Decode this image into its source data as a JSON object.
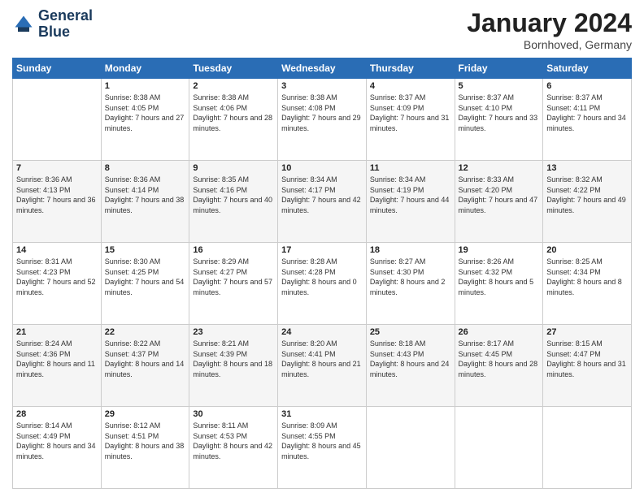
{
  "logo": {
    "line1": "General",
    "line2": "Blue"
  },
  "title": "January 2024",
  "subtitle": "Bornhoved, Germany",
  "weekdays": [
    "Sunday",
    "Monday",
    "Tuesday",
    "Wednesday",
    "Thursday",
    "Friday",
    "Saturday"
  ],
  "weeks": [
    [
      {
        "day": "",
        "sunrise": "",
        "sunset": "",
        "daylight": ""
      },
      {
        "day": "1",
        "sunrise": "Sunrise: 8:38 AM",
        "sunset": "Sunset: 4:05 PM",
        "daylight": "Daylight: 7 hours and 27 minutes."
      },
      {
        "day": "2",
        "sunrise": "Sunrise: 8:38 AM",
        "sunset": "Sunset: 4:06 PM",
        "daylight": "Daylight: 7 hours and 28 minutes."
      },
      {
        "day": "3",
        "sunrise": "Sunrise: 8:38 AM",
        "sunset": "Sunset: 4:08 PM",
        "daylight": "Daylight: 7 hours and 29 minutes."
      },
      {
        "day": "4",
        "sunrise": "Sunrise: 8:37 AM",
        "sunset": "Sunset: 4:09 PM",
        "daylight": "Daylight: 7 hours and 31 minutes."
      },
      {
        "day": "5",
        "sunrise": "Sunrise: 8:37 AM",
        "sunset": "Sunset: 4:10 PM",
        "daylight": "Daylight: 7 hours and 33 minutes."
      },
      {
        "day": "6",
        "sunrise": "Sunrise: 8:37 AM",
        "sunset": "Sunset: 4:11 PM",
        "daylight": "Daylight: 7 hours and 34 minutes."
      }
    ],
    [
      {
        "day": "7",
        "sunrise": "Sunrise: 8:36 AM",
        "sunset": "Sunset: 4:13 PM",
        "daylight": "Daylight: 7 hours and 36 minutes."
      },
      {
        "day": "8",
        "sunrise": "Sunrise: 8:36 AM",
        "sunset": "Sunset: 4:14 PM",
        "daylight": "Daylight: 7 hours and 38 minutes."
      },
      {
        "day": "9",
        "sunrise": "Sunrise: 8:35 AM",
        "sunset": "Sunset: 4:16 PM",
        "daylight": "Daylight: 7 hours and 40 minutes."
      },
      {
        "day": "10",
        "sunrise": "Sunrise: 8:34 AM",
        "sunset": "Sunset: 4:17 PM",
        "daylight": "Daylight: 7 hours and 42 minutes."
      },
      {
        "day": "11",
        "sunrise": "Sunrise: 8:34 AM",
        "sunset": "Sunset: 4:19 PM",
        "daylight": "Daylight: 7 hours and 44 minutes."
      },
      {
        "day": "12",
        "sunrise": "Sunrise: 8:33 AM",
        "sunset": "Sunset: 4:20 PM",
        "daylight": "Daylight: 7 hours and 47 minutes."
      },
      {
        "day": "13",
        "sunrise": "Sunrise: 8:32 AM",
        "sunset": "Sunset: 4:22 PM",
        "daylight": "Daylight: 7 hours and 49 minutes."
      }
    ],
    [
      {
        "day": "14",
        "sunrise": "Sunrise: 8:31 AM",
        "sunset": "Sunset: 4:23 PM",
        "daylight": "Daylight: 7 hours and 52 minutes."
      },
      {
        "day": "15",
        "sunrise": "Sunrise: 8:30 AM",
        "sunset": "Sunset: 4:25 PM",
        "daylight": "Daylight: 7 hours and 54 minutes."
      },
      {
        "day": "16",
        "sunrise": "Sunrise: 8:29 AM",
        "sunset": "Sunset: 4:27 PM",
        "daylight": "Daylight: 7 hours and 57 minutes."
      },
      {
        "day": "17",
        "sunrise": "Sunrise: 8:28 AM",
        "sunset": "Sunset: 4:28 PM",
        "daylight": "Daylight: 8 hours and 0 minutes."
      },
      {
        "day": "18",
        "sunrise": "Sunrise: 8:27 AM",
        "sunset": "Sunset: 4:30 PM",
        "daylight": "Daylight: 8 hours and 2 minutes."
      },
      {
        "day": "19",
        "sunrise": "Sunrise: 8:26 AM",
        "sunset": "Sunset: 4:32 PM",
        "daylight": "Daylight: 8 hours and 5 minutes."
      },
      {
        "day": "20",
        "sunrise": "Sunrise: 8:25 AM",
        "sunset": "Sunset: 4:34 PM",
        "daylight": "Daylight: 8 hours and 8 minutes."
      }
    ],
    [
      {
        "day": "21",
        "sunrise": "Sunrise: 8:24 AM",
        "sunset": "Sunset: 4:36 PM",
        "daylight": "Daylight: 8 hours and 11 minutes."
      },
      {
        "day": "22",
        "sunrise": "Sunrise: 8:22 AM",
        "sunset": "Sunset: 4:37 PM",
        "daylight": "Daylight: 8 hours and 14 minutes."
      },
      {
        "day": "23",
        "sunrise": "Sunrise: 8:21 AM",
        "sunset": "Sunset: 4:39 PM",
        "daylight": "Daylight: 8 hours and 18 minutes."
      },
      {
        "day": "24",
        "sunrise": "Sunrise: 8:20 AM",
        "sunset": "Sunset: 4:41 PM",
        "daylight": "Daylight: 8 hours and 21 minutes."
      },
      {
        "day": "25",
        "sunrise": "Sunrise: 8:18 AM",
        "sunset": "Sunset: 4:43 PM",
        "daylight": "Daylight: 8 hours and 24 minutes."
      },
      {
        "day": "26",
        "sunrise": "Sunrise: 8:17 AM",
        "sunset": "Sunset: 4:45 PM",
        "daylight": "Daylight: 8 hours and 28 minutes."
      },
      {
        "day": "27",
        "sunrise": "Sunrise: 8:15 AM",
        "sunset": "Sunset: 4:47 PM",
        "daylight": "Daylight: 8 hours and 31 minutes."
      }
    ],
    [
      {
        "day": "28",
        "sunrise": "Sunrise: 8:14 AM",
        "sunset": "Sunset: 4:49 PM",
        "daylight": "Daylight: 8 hours and 34 minutes."
      },
      {
        "day": "29",
        "sunrise": "Sunrise: 8:12 AM",
        "sunset": "Sunset: 4:51 PM",
        "daylight": "Daylight: 8 hours and 38 minutes."
      },
      {
        "day": "30",
        "sunrise": "Sunrise: 8:11 AM",
        "sunset": "Sunset: 4:53 PM",
        "daylight": "Daylight: 8 hours and 42 minutes."
      },
      {
        "day": "31",
        "sunrise": "Sunrise: 8:09 AM",
        "sunset": "Sunset: 4:55 PM",
        "daylight": "Daylight: 8 hours and 45 minutes."
      },
      {
        "day": "",
        "sunrise": "",
        "sunset": "",
        "daylight": ""
      },
      {
        "day": "",
        "sunrise": "",
        "sunset": "",
        "daylight": ""
      },
      {
        "day": "",
        "sunrise": "",
        "sunset": "",
        "daylight": ""
      }
    ]
  ]
}
